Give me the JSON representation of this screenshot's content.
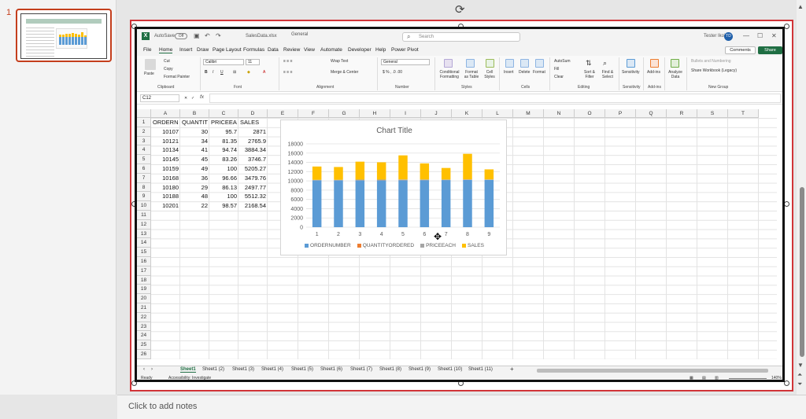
{
  "thumbnail": {
    "number": "1"
  },
  "notes": {
    "placeholder": "Click to add notes"
  },
  "excel": {
    "autosave": "AutoSave",
    "autosave_state": "Off",
    "file_name": "SalesData.xlsx",
    "general": "General",
    "search_placeholder": "Search",
    "user": "Tester Ikoi",
    "user_initials": "TD",
    "menu": [
      "File",
      "Home",
      "Insert",
      "Draw",
      "Page Layout",
      "Formulas",
      "Data",
      "Review",
      "View",
      "Automate",
      "Developer",
      "Help",
      "Power Pivot"
    ],
    "comments": "Comments",
    "share": "Share",
    "ribbon": {
      "paste": "Paste",
      "cut": "Cut",
      "copy": "Copy",
      "format_painter": "Format Painter",
      "font_name": "Calibri",
      "font_size": "11",
      "wrap_text": "Wrap Text",
      "merge_center": "Merge & Center",
      "number_format": "General",
      "conditional": "Conditional Formatting",
      "format_as_table": "Format as Table",
      "cell_styles": "Cell Styles",
      "insert": "Insert",
      "delete": "Delete",
      "format": "Format",
      "autosum": "AutoSum",
      "fill": "Fill",
      "clear": "Clear",
      "sort_filter": "Sort & Filter",
      "find_select": "Find & Select",
      "sensitivity": "Sensitivity",
      "addins": "Add-ins",
      "analyze": "Analyze Data",
      "bullets": "Bullets and Numbering",
      "share_workbook": "Share Workbook (Legacy)",
      "groups": [
        "Clipboard",
        "Font",
        "Alignment",
        "Number",
        "Styles",
        "Cells",
        "Editing",
        "Sensitivity",
        "Add-ins",
        "New Group"
      ]
    },
    "name_box": "C12",
    "fx": "fx",
    "columns": [
      "A",
      "B",
      "C",
      "D",
      "E",
      "F",
      "G",
      "H",
      "I",
      "J",
      "K",
      "L",
      "M",
      "N",
      "O",
      "P",
      "Q",
      "R",
      "S",
      "T",
      "U"
    ],
    "rows": [
      "1",
      "2",
      "3",
      "4",
      "5",
      "6",
      "7",
      "8",
      "9",
      "10",
      "11",
      "12",
      "13",
      "14",
      "15",
      "16",
      "17",
      "18",
      "19",
      "20",
      "21",
      "22",
      "23",
      "24",
      "25",
      "26"
    ],
    "headers": [
      "ORDERNU",
      "QUANTITY",
      "PRICEEACI",
      "SALES"
    ],
    "data": [
      [
        "10107",
        "30",
        "95.7",
        "2871"
      ],
      [
        "10121",
        "34",
        "81.35",
        "2765.9"
      ],
      [
        "10134",
        "41",
        "94.74",
        "3884.34"
      ],
      [
        "10145",
        "45",
        "83.26",
        "3746.7"
      ],
      [
        "10159",
        "49",
        "100",
        "5205.27"
      ],
      [
        "10168",
        "36",
        "96.66",
        "3479.76"
      ],
      [
        "10180",
        "29",
        "86.13",
        "2497.77"
      ],
      [
        "10188",
        "48",
        "100",
        "5512.32"
      ],
      [
        "10201",
        "22",
        "98.57",
        "2168.54"
      ]
    ],
    "sheet_tabs": [
      "Sheet1",
      "Sheet1 (2)",
      "Sheet1 (3)",
      "Sheet1 (4)",
      "Sheet1 (5)",
      "Sheet1 (6)",
      "Sheet1 (7)",
      "Sheet1 (8)",
      "Sheet1 (9)",
      "Sheet1 (10)",
      "Sheet1 (11)"
    ],
    "status_ready": "Ready",
    "status_accessibility": "Accessibility: Investigate",
    "zoom": "140%"
  },
  "chart_data": {
    "type": "bar",
    "stacked": true,
    "title": "Chart Title",
    "categories": [
      "1",
      "2",
      "3",
      "4",
      "5",
      "6",
      "7",
      "8",
      "9"
    ],
    "ylim": [
      0,
      18000
    ],
    "yticks": [
      "0",
      "2000",
      "4000",
      "6000",
      "8000",
      "10000",
      "12000",
      "14000",
      "16000",
      "18000"
    ],
    "series": [
      {
        "name": "ORDERNUMBER",
        "color": "#5b9bd5",
        "values": [
          10107,
          10121,
          10134,
          10145,
          10159,
          10168,
          10180,
          10188,
          10201
        ]
      },
      {
        "name": "QUANTITYORDERED",
        "color": "#ed7d31",
        "values": [
          30,
          34,
          41,
          45,
          49,
          36,
          29,
          48,
          22
        ]
      },
      {
        "name": "PRICEEACH",
        "color": "#a5a5a5",
        "values": [
          95.7,
          81.35,
          94.74,
          83.26,
          100,
          96.66,
          86.13,
          100,
          98.57
        ]
      },
      {
        "name": "SALES",
        "color": "#ffc000",
        "values": [
          2871,
          2765.9,
          3884.34,
          3746.7,
          5205.27,
          3479.76,
          2497.77,
          5512.32,
          2168.54
        ]
      }
    ],
    "legend": "bottom",
    "grid": true
  }
}
